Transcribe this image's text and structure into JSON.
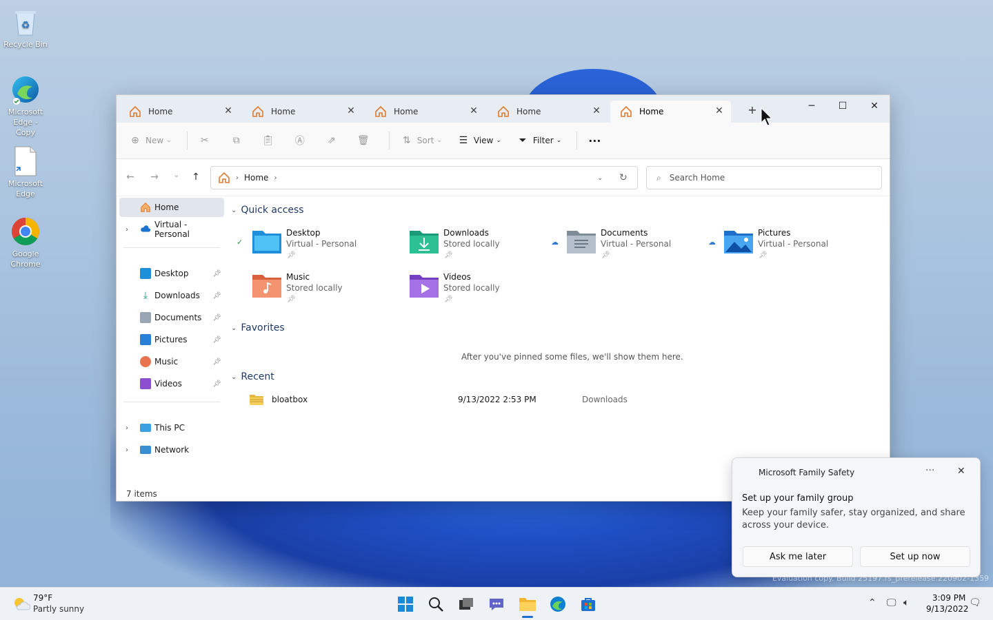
{
  "desktop": {
    "icons": [
      {
        "label": "Recycle Bin",
        "icon": "recycle-bin-icon"
      },
      {
        "label": "Microsoft Edge - Copy",
        "icon": "edge-icon"
      },
      {
        "label": "Microsoft Edge",
        "icon": "file-icon"
      },
      {
        "label": "Google Chrome",
        "icon": "chrome-icon"
      }
    ],
    "watermark": "Evaluation copy. Build 25197.rs_prerelease.220902-1359"
  },
  "explorer": {
    "tabs": [
      {
        "label": "Home",
        "active": false
      },
      {
        "label": "Home",
        "active": false
      },
      {
        "label": "Home",
        "active": false
      },
      {
        "label": "Home",
        "active": false
      },
      {
        "label": "Home",
        "active": true
      }
    ],
    "new_tab": "+",
    "toolbar": {
      "new_label": "New",
      "sort_label": "Sort",
      "view_label": "View",
      "filter_label": "Filter",
      "more_label": "···"
    },
    "address": {
      "crumb": "Home"
    },
    "search": {
      "placeholder": "Search Home"
    },
    "sidebar": {
      "top": [
        {
          "label": "Home",
          "icon": "home-icon",
          "selected": true
        },
        {
          "label": "Virtual - Personal",
          "icon": "cloud-icon"
        }
      ],
      "pinned": [
        {
          "label": "Desktop",
          "icon": "desktop-folder-icon"
        },
        {
          "label": "Downloads",
          "icon": "downloads-icon"
        },
        {
          "label": "Documents",
          "icon": "documents-icon"
        },
        {
          "label": "Pictures",
          "icon": "pictures-icon"
        },
        {
          "label": "Music",
          "icon": "music-icon"
        },
        {
          "label": "Videos",
          "icon": "videos-icon"
        }
      ],
      "bottom": [
        {
          "label": "This PC",
          "icon": "this-pc-icon"
        },
        {
          "label": "Network",
          "icon": "network-icon"
        }
      ]
    },
    "quick_access": {
      "heading": "Quick access",
      "items": [
        {
          "name": "Desktop",
          "location": "Virtual - Personal",
          "color": "#1e8fd8"
        },
        {
          "name": "Downloads",
          "location": "Stored locally",
          "color": "#1a9a78"
        },
        {
          "name": "Documents",
          "location": "Virtual - Personal",
          "color": "#8a98a8"
        },
        {
          "name": "Pictures",
          "location": "Virtual - Personal",
          "color": "#2a7fd6"
        },
        {
          "name": "Music",
          "location": "Stored locally",
          "color": "#e8734f"
        },
        {
          "name": "Videos",
          "location": "Stored locally",
          "color": "#8b4fd0"
        }
      ]
    },
    "favorites": {
      "heading": "Favorites",
      "empty": "After you've pinned some files, we'll show them here."
    },
    "recent": {
      "heading": "Recent",
      "rows": [
        {
          "name": "bloatbox",
          "date": "9/13/2022 2:53 PM",
          "location": "Downloads"
        }
      ]
    },
    "status": "7 items"
  },
  "toast": {
    "app": "Microsoft Family Safety",
    "more": "···",
    "title": "Set up your family group",
    "body": "Keep your family safer, stay organized, and share across your device.",
    "btn_later": "Ask me later",
    "btn_setup": "Set up now"
  },
  "taskbar": {
    "weather_temp": "79°F",
    "weather_desc": "Partly sunny",
    "time": "3:09 PM",
    "date": "9/13/2022"
  }
}
